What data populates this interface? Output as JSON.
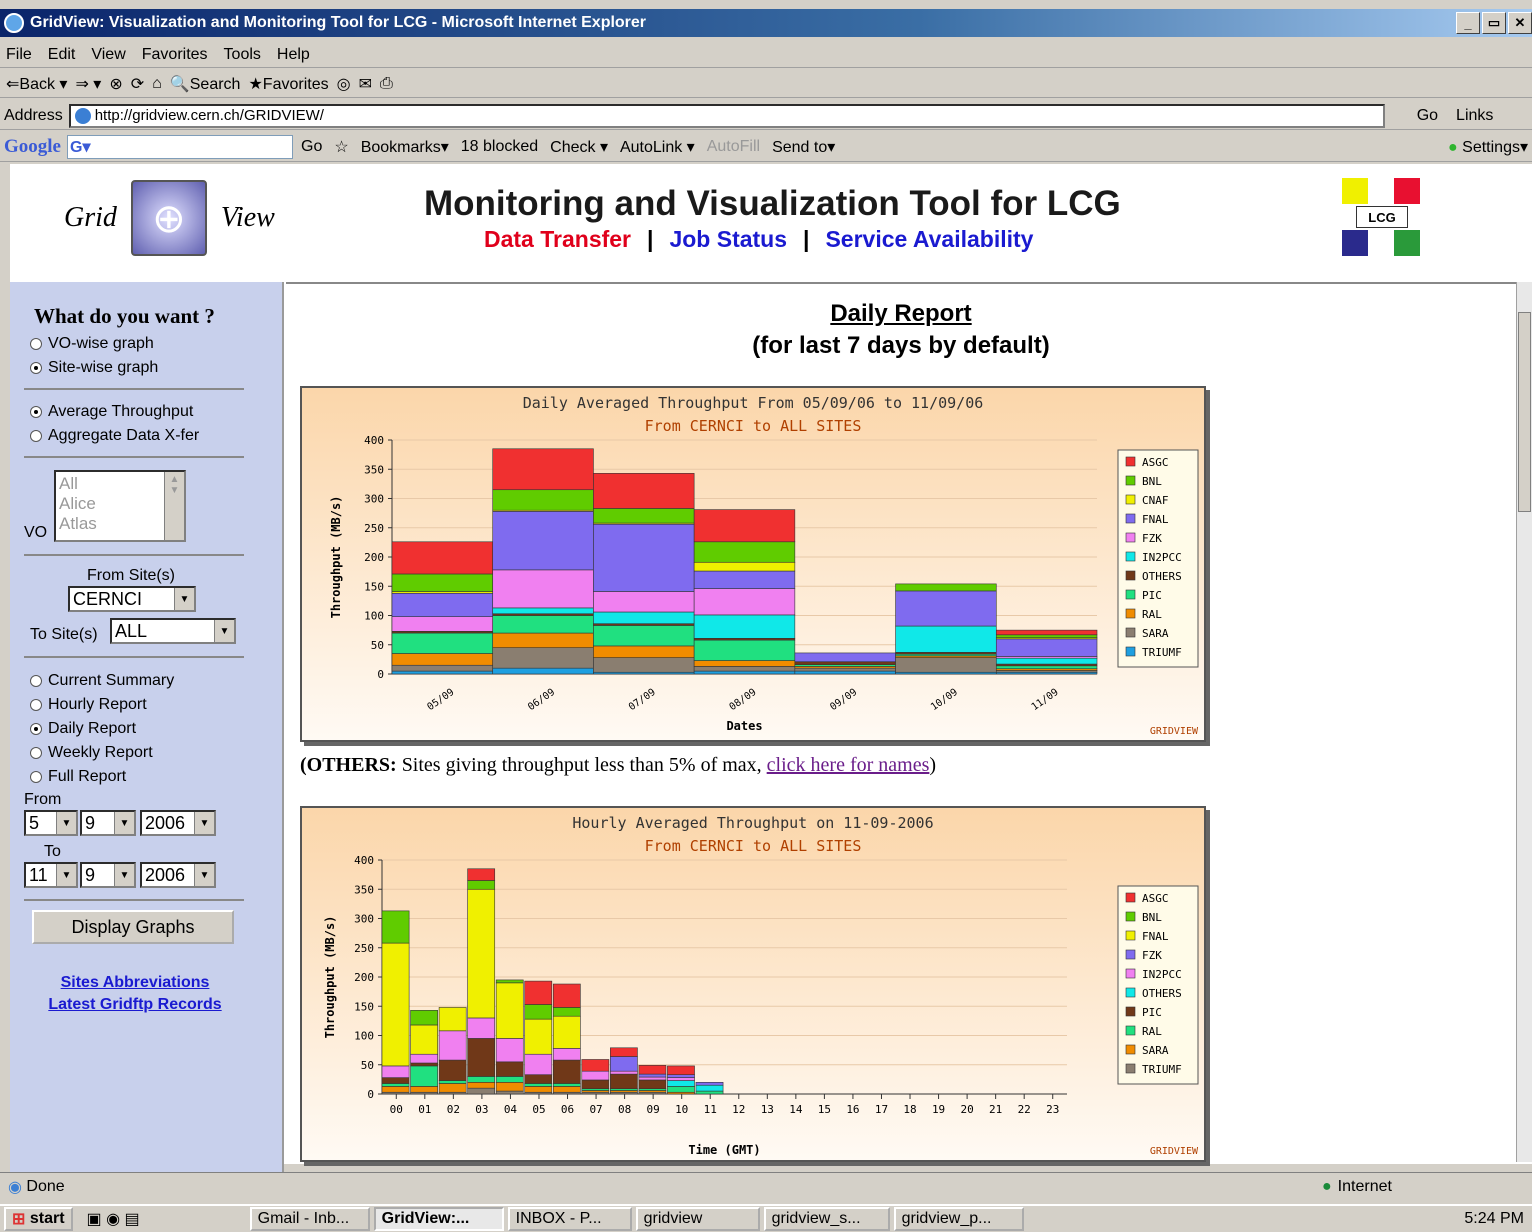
{
  "window": {
    "title": "GridView: Visualization and Monitoring Tool for LCG - Microsoft Internet Explorer"
  },
  "menu": [
    "File",
    "Edit",
    "View",
    "Favorites",
    "Tools",
    "Help"
  ],
  "toolbar": {
    "back": "⇐Back ▾",
    "forward": "⇒ ▾",
    "search": "Search",
    "favorites": "Favorites"
  },
  "address": {
    "label": "Address",
    "url": "http://gridview.cern.ch/GRIDVIEW/",
    "go": "Go",
    "links": "Links"
  },
  "googlebar": {
    "logo": "Google",
    "go": "Go",
    "bookmarks": "Bookmarks▾",
    "blocked": "18 blocked",
    "check": "Check ▾",
    "autolink": "AutoLink ▾",
    "autofill": "AutoFill",
    "sendto": "Send to▾",
    "settings": "Settings▾"
  },
  "banner": {
    "logo_left": "Grid",
    "logo_right": "View",
    "title": "Monitoring and Visualization Tool for LCG",
    "links": {
      "data_transfer": "Data Transfer",
      "job_status": "Job Status",
      "service": "Service Availability",
      "sep": "|"
    },
    "lcg": "LCG"
  },
  "sidebar": {
    "heading": "What do you want ?",
    "graph_types": [
      {
        "label": "VO-wise graph",
        "checked": false
      },
      {
        "label": "Site-wise graph",
        "checked": true
      }
    ],
    "metrics": [
      {
        "label": "Average Throughput",
        "checked": true
      },
      {
        "label": "Aggregate Data X-fer",
        "checked": false
      }
    ],
    "vo_label": "VO",
    "vo_options": [
      "All",
      "Alice",
      "Atlas"
    ],
    "from_site_label": "From Site(s)",
    "from_site": "CERNCI",
    "to_site_label": "To Site(s)",
    "to_site": "ALL",
    "reports": [
      {
        "label": "Current Summary",
        "checked": false
      },
      {
        "label": "Hourly Report",
        "checked": false
      },
      {
        "label": "Daily Report",
        "checked": true
      },
      {
        "label": "Weekly Report",
        "checked": false
      },
      {
        "label": "Full Report",
        "checked": false
      }
    ],
    "from_label": "From",
    "from": {
      "day": "5",
      "month": "9",
      "year": "2006"
    },
    "to_label": "To",
    "to": {
      "day": "11",
      "month": "9",
      "year": "2006"
    },
    "button": "Display Graphs",
    "link1": "Sites Abbreviations",
    "link2": "Latest Gridftp Records"
  },
  "report": {
    "title": "Daily Report",
    "subtitle": "(for last 7 days by default)",
    "note_bold": "(OTHERS:",
    "note_text": " Sites giving throughput less than 5% of max, ",
    "note_link": "click here for names",
    "note_end": ")"
  },
  "chart_data": [
    {
      "type": "bar",
      "stacked": true,
      "title": "Daily Averaged Throughput From 05/09/06 to 11/09/06",
      "subtitle": "From CERNCI to ALL SITES",
      "xlabel": "Dates",
      "ylabel": "Throughput (MB/s)",
      "ylim": [
        0,
        400
      ],
      "yticks": [
        0,
        50,
        100,
        150,
        200,
        250,
        300,
        350,
        400
      ],
      "categories": [
        "05/09",
        "06/09",
        "07/09",
        "08/09",
        "09/09",
        "10/09",
        "11/09"
      ],
      "series": [
        {
          "name": "TRIUMF",
          "color": "#1e9fe0",
          "values": [
            5,
            10,
            3,
            5,
            5,
            3,
            3
          ]
        },
        {
          "name": "SARA",
          "color": "#8a7e70",
          "values": [
            10,
            35,
            25,
            8,
            5,
            25,
            3
          ]
        },
        {
          "name": "RAL",
          "color": "#f08c00",
          "values": [
            20,
            25,
            20,
            10,
            3,
            3,
            3
          ]
        },
        {
          "name": "PIC",
          "color": "#20e080",
          "values": [
            35,
            30,
            35,
            35,
            3,
            3,
            5
          ]
        },
        {
          "name": "OTHERS",
          "color": "#703818",
          "values": [
            3,
            3,
            3,
            3,
            5,
            3,
            3
          ]
        },
        {
          "name": "IN2PCC",
          "color": "#10e8e8",
          "values": [
            0,
            10,
            20,
            40,
            0,
            45,
            10
          ]
        },
        {
          "name": "FZK",
          "color": "#f080f0",
          "values": [
            25,
            65,
            35,
            45,
            0,
            0,
            3
          ]
        },
        {
          "name": "FNAL",
          "color": "#7f6bef",
          "values": [
            40,
            100,
            115,
            30,
            15,
            60,
            30
          ]
        },
        {
          "name": "CNAF",
          "color": "#f0f000",
          "values": [
            3,
            2,
            2,
            15,
            0,
            0,
            2
          ]
        },
        {
          "name": "BNL",
          "color": "#60cc00",
          "values": [
            30,
            35,
            25,
            35,
            0,
            12,
            5
          ]
        },
        {
          "name": "ASGC",
          "color": "#f03030",
          "values": [
            55,
            70,
            60,
            55,
            0,
            0,
            8
          ]
        }
      ],
      "legend": [
        "ASGC",
        "BNL",
        "CNAF",
        "FNAL",
        "FZK",
        "IN2PCC",
        "OTHERS",
        "PIC",
        "RAL",
        "SARA",
        "TRIUMF"
      ],
      "watermark": "GRIDVIEW"
    },
    {
      "type": "bar",
      "stacked": true,
      "title": "Hourly Averaged Throughput on 11-09-2006",
      "subtitle": "From CERNCI to ALL SITES",
      "xlabel": "Time (GMT)",
      "ylabel": "Throughput (MB/s)",
      "ylim": [
        0,
        400
      ],
      "yticks": [
        0,
        50,
        100,
        150,
        200,
        250,
        300,
        350,
        400
      ],
      "categories": [
        "00",
        "01",
        "02",
        "03",
        "04",
        "05",
        "06",
        "07",
        "08",
        "09",
        "10",
        "11",
        "12",
        "13",
        "14",
        "15",
        "16",
        "17",
        "18",
        "19",
        "20",
        "21",
        "22",
        "23"
      ],
      "series": [
        {
          "name": "TRIUMF",
          "color": "#8a7e70",
          "values": [
            3,
            3,
            3,
            10,
            5,
            3,
            3,
            3,
            3,
            3,
            0,
            0,
            0,
            0,
            0,
            0,
            0,
            0,
            0,
            0,
            0,
            0,
            0,
            0
          ]
        },
        {
          "name": "SARA",
          "color": "#f08c00",
          "values": [
            10,
            10,
            15,
            10,
            15,
            10,
            10,
            3,
            3,
            3,
            3,
            0,
            0,
            0,
            0,
            0,
            0,
            0,
            0,
            0,
            0,
            0,
            0,
            0
          ]
        },
        {
          "name": "RAL",
          "color": "#20e080",
          "values": [
            5,
            35,
            5,
            10,
            10,
            5,
            5,
            3,
            3,
            3,
            10,
            5,
            0,
            0,
            0,
            0,
            0,
            0,
            0,
            0,
            0,
            0,
            0,
            0
          ]
        },
        {
          "name": "PIC",
          "color": "#703818",
          "values": [
            10,
            5,
            35,
            65,
            25,
            15,
            40,
            15,
            25,
            15,
            0,
            0,
            0,
            0,
            0,
            0,
            0,
            0,
            0,
            0,
            0,
            0,
            0,
            0
          ]
        },
        {
          "name": "OTHERS",
          "color": "#10e8e8",
          "values": [
            0,
            0,
            0,
            0,
            0,
            0,
            0,
            0,
            0,
            0,
            10,
            10,
            0,
            0,
            0,
            0,
            0,
            0,
            0,
            0,
            0,
            0,
            0,
            0
          ]
        },
        {
          "name": "IN2PCC",
          "color": "#f080f0",
          "values": [
            20,
            15,
            50,
            35,
            40,
            35,
            20,
            15,
            5,
            5,
            5,
            0,
            0,
            0,
            0,
            0,
            0,
            0,
            0,
            0,
            0,
            0,
            0,
            0
          ]
        },
        {
          "name": "FZK",
          "color": "#7f6bef",
          "values": [
            0,
            0,
            0,
            0,
            0,
            0,
            0,
            0,
            25,
            5,
            5,
            5,
            0,
            0,
            0,
            0,
            0,
            0,
            0,
            0,
            0,
            0,
            0,
            0
          ]
        },
        {
          "name": "FNAL",
          "color": "#f0f000",
          "values": [
            210,
            50,
            40,
            220,
            95,
            60,
            55,
            0,
            0,
            0,
            0,
            0,
            0,
            0,
            0,
            0,
            0,
            0,
            0,
            0,
            0,
            0,
            0,
            0
          ]
        },
        {
          "name": "BNL",
          "color": "#60cc00",
          "values": [
            55,
            25,
            0,
            15,
            5,
            25,
            15,
            0,
            0,
            0,
            0,
            0,
            0,
            0,
            0,
            0,
            0,
            0,
            0,
            0,
            0,
            0,
            0,
            0
          ]
        },
        {
          "name": "ASGC",
          "color": "#f03030",
          "values": [
            0,
            0,
            0,
            20,
            0,
            40,
            40,
            20,
            15,
            15,
            15,
            0,
            0,
            0,
            0,
            0,
            0,
            0,
            0,
            0,
            0,
            0,
            0,
            0
          ]
        }
      ],
      "legend": [
        "ASGC",
        "BNL",
        "FNAL",
        "FZK",
        "IN2PCC",
        "OTHERS",
        "PIC",
        "RAL",
        "SARA",
        "TRIUMF"
      ],
      "watermark": "GRIDVIEW"
    }
  ],
  "status": {
    "text": "Done",
    "zone": "Internet"
  },
  "taskbar": {
    "start": "start",
    "tasks": [
      "Gmail - Inb...",
      "GridView:...",
      "INBOX - P...",
      "gridview",
      "gridview_s...",
      "gridview_p..."
    ],
    "clock": "5:24 PM"
  }
}
